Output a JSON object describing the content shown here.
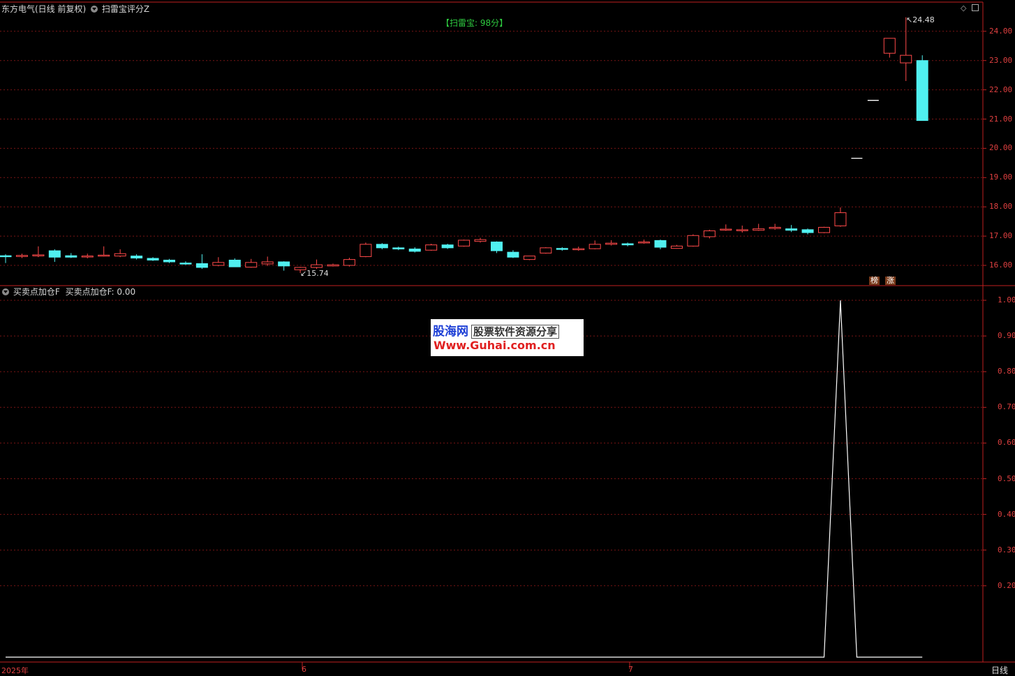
{
  "header": {
    "stock": "东方电气(日线 前复权)",
    "indicator": "扫雷宝评分Z",
    "score_text": "【扫雷宝: 98分】"
  },
  "lower_panel": {
    "indicator_name": "买卖点加仓F",
    "value_text": "买卖点加仓F: 0.00"
  },
  "badges": {
    "list": "榜",
    "rise": "涨"
  },
  "annotations": {
    "high": "24.48",
    "low": "15.74"
  },
  "dates": {
    "year": "2025年",
    "m6": "6",
    "m7": "7"
  },
  "period": "日线",
  "watermark": {
    "brand": "股海网",
    "slogan": "股票软件资源分享",
    "url": "Www.Guhai.com.cn"
  },
  "colors": {
    "up": "#ff4a4a",
    "down": "#50f0f0",
    "grid": "#7a1515",
    "axis": "#c02020",
    "signal": "#ffffff"
  },
  "price_axis": {
    "min": 15.6,
    "max": 24.6,
    "ticks": [
      "16.00",
      "17.00",
      "18.00",
      "19.00",
      "20.00",
      "21.00",
      "22.00",
      "23.00",
      "24.00"
    ]
  },
  "signal_axis": {
    "ticks": [
      "0.20",
      "0.30",
      "0.40",
      "0.50",
      "0.60",
      "0.70",
      "0.80",
      "0.90",
      "1.00"
    ]
  },
  "candles": [
    [
      16.33,
      16.38,
      16.08,
      16.3
    ],
    [
      16.32,
      16.4,
      16.25,
      16.34
    ],
    [
      16.34,
      16.65,
      16.28,
      16.36
    ],
    [
      16.5,
      16.55,
      16.12,
      16.28
    ],
    [
      16.33,
      16.42,
      16.25,
      16.28
    ],
    [
      16.3,
      16.4,
      16.24,
      16.32
    ],
    [
      16.33,
      16.65,
      16.3,
      16.35
    ],
    [
      16.32,
      16.55,
      16.28,
      16.4
    ],
    [
      16.32,
      16.38,
      16.2,
      16.25
    ],
    [
      16.24,
      16.28,
      16.15,
      16.18
    ],
    [
      16.18,
      16.22,
      16.08,
      16.12
    ],
    [
      16.08,
      16.14,
      16.02,
      16.05
    ],
    [
      16.06,
      16.38,
      15.88,
      15.93
    ],
    [
      16.0,
      16.28,
      15.97,
      16.1
    ],
    [
      16.18,
      16.24,
      15.96,
      15.95
    ],
    [
      15.94,
      16.22,
      15.92,
      16.1
    ],
    [
      16.05,
      16.3,
      15.98,
      16.12
    ],
    [
      16.12,
      16.14,
      15.82,
      15.98
    ],
    [
      15.85,
      15.95,
      15.74,
      15.93
    ],
    [
      15.93,
      16.2,
      15.88,
      16.02
    ],
    [
      15.98,
      16.06,
      15.96,
      16.02
    ],
    [
      16.0,
      16.26,
      15.96,
      16.2
    ],
    [
      16.3,
      16.78,
      16.28,
      16.72
    ],
    [
      16.72,
      16.76,
      16.55,
      16.6
    ],
    [
      16.6,
      16.64,
      16.52,
      16.56
    ],
    [
      16.56,
      16.62,
      16.44,
      16.48
    ],
    [
      16.52,
      16.74,
      16.5,
      16.7
    ],
    [
      16.7,
      16.74,
      16.56,
      16.6
    ],
    [
      16.66,
      16.88,
      16.64,
      16.86
    ],
    [
      16.82,
      16.94,
      16.78,
      16.88
    ],
    [
      16.8,
      16.82,
      16.42,
      16.5
    ],
    [
      16.45,
      16.52,
      16.25,
      16.28
    ],
    [
      16.2,
      16.32,
      16.18,
      16.32
    ],
    [
      16.42,
      16.62,
      16.4,
      16.6
    ],
    [
      16.58,
      16.62,
      16.5,
      16.56
    ],
    [
      16.55,
      16.64,
      16.5,
      16.57
    ],
    [
      16.57,
      16.85,
      16.55,
      16.72
    ],
    [
      16.72,
      16.86,
      16.68,
      16.76
    ],
    [
      16.74,
      16.78,
      16.65,
      16.7
    ],
    [
      16.78,
      16.88,
      16.74,
      16.8
    ],
    [
      16.85,
      16.88,
      16.55,
      16.62
    ],
    [
      16.58,
      16.7,
      16.57,
      16.66
    ],
    [
      16.66,
      17.06,
      16.64,
      17.02
    ],
    [
      16.98,
      17.22,
      16.92,
      17.18
    ],
    [
      17.22,
      17.4,
      17.18,
      17.24
    ],
    [
      17.2,
      17.36,
      17.12,
      17.22
    ],
    [
      17.2,
      17.42,
      17.18,
      17.25
    ],
    [
      17.26,
      17.42,
      17.22,
      17.3
    ],
    [
      17.25,
      17.38,
      17.14,
      17.2
    ],
    [
      17.22,
      17.26,
      17.06,
      17.12
    ],
    [
      17.12,
      17.32,
      17.1,
      17.3
    ],
    [
      17.35,
      17.98,
      17.32,
      17.8
    ],
    [
      19.66,
      19.66,
      19.66,
      19.66
    ],
    [
      21.64,
      21.64,
      21.64,
      21.64
    ],
    [
      23.25,
      23.76,
      23.1,
      23.76
    ],
    [
      22.92,
      24.48,
      22.3,
      23.18
    ],
    [
      23.0,
      23.18,
      20.95,
      20.95
    ]
  ],
  "signal": [
    0,
    0,
    0,
    0,
    0,
    0,
    0,
    0,
    0,
    0,
    0,
    0,
    0,
    0,
    0,
    0,
    0,
    0,
    0,
    0,
    0,
    0,
    0,
    0,
    0,
    0,
    0,
    0,
    0,
    0,
    0,
    0,
    0,
    0,
    0,
    0,
    0,
    0,
    0,
    0,
    0,
    0,
    0,
    0,
    0,
    0,
    0,
    0,
    0,
    0,
    0,
    1,
    0,
    0,
    0,
    0,
    0
  ]
}
